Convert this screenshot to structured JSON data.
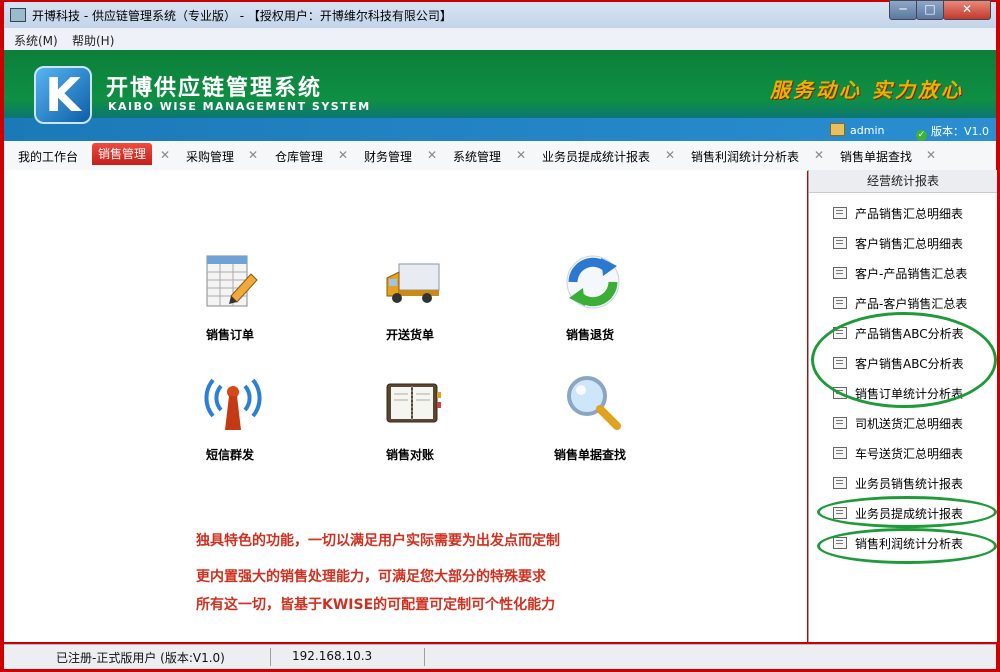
{
  "window": {
    "title": "开博科技 - 供应链管理系统（专业版） - 【授权用户：开博维尔科技有限公司】",
    "min_label": "─",
    "max_label": "□",
    "close_label": "✕"
  },
  "menu": {
    "items": [
      "系统(M)",
      "帮助(H)"
    ]
  },
  "banner": {
    "logo_letter": "K",
    "title_cn": "开博供应链管理系统",
    "title_en": "KAIBO WISE MANAGEMENT SYSTEM",
    "slogan": "服务动心 实力放心",
    "user": "admin",
    "version": "版本：V1.0"
  },
  "tabs": [
    {
      "label": "我的工作台",
      "active": false
    },
    {
      "label": "销售管理",
      "active": true
    },
    {
      "label": "采购管理",
      "active": false
    },
    {
      "label": "仓库管理",
      "active": false
    },
    {
      "label": "财务管理",
      "active": false
    },
    {
      "label": "系统管理",
      "active": false
    },
    {
      "label": "业务员提成统计报表",
      "active": false
    },
    {
      "label": "销售利润统计分析表",
      "active": false
    },
    {
      "label": "销售单据查找",
      "active": false
    }
  ],
  "tab_close": "✕",
  "modules": [
    {
      "label": "销售订单",
      "icon": "spreadsheet-pencil-icon"
    },
    {
      "label": "开送货单",
      "icon": "delivery-truck-icon"
    },
    {
      "label": "销售退货",
      "icon": "refresh-arrows-icon"
    },
    {
      "label": "短信群发",
      "icon": "broadcast-antenna-icon"
    },
    {
      "label": "销售对账",
      "icon": "ledger-book-icon"
    },
    {
      "label": "销售单据查找",
      "icon": "magnifier-icon"
    }
  ],
  "messages": [
    "独具特色的功能，一切以满足用户实际需要为出发点而定制",
    "更内置强大的销售处理能力，可满足您大部分的特殊要求",
    "所有这一切，皆基于KWISE的可配置可定制可个性化能力"
  ],
  "right_panel": {
    "title": "经营统计报表",
    "items": [
      "产品销售汇总明细表",
      "客户销售汇总明细表",
      "客户-产品销售汇总表",
      "产品-客户销售汇总表",
      "产品销售ABC分析表",
      "客户销售ABC分析表",
      "销售订单统计分析表",
      "司机送货汇总明细表",
      "车号送货汇总明细表",
      "业务员销售统计报表",
      "业务员提成统计报表",
      "销售利润统计分析表"
    ]
  },
  "status": {
    "registration": "已注册-正式版用户 (版本:V1.0)",
    "ip": "192.168.10.3"
  },
  "colors": {
    "frame_red": "#cc0000",
    "banner_green": "#0f8f44",
    "active_tab": "#d62a22",
    "message_red": "#d03020",
    "oval_green": "#1f9a3a"
  }
}
